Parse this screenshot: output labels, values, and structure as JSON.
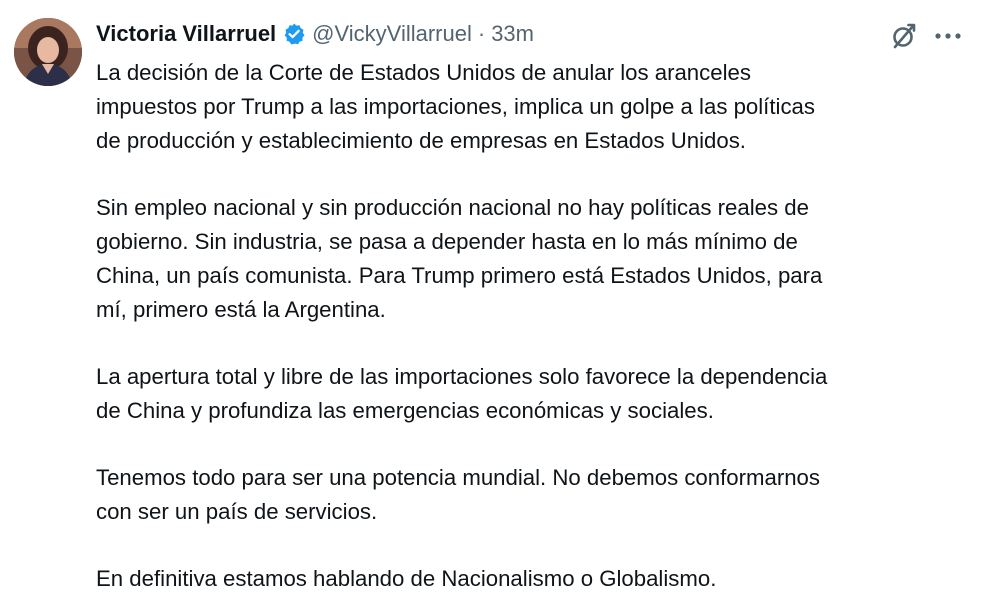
{
  "tweet": {
    "display_name": "Victoria Villarruel",
    "handle": "@VickyVillarruel",
    "separator": "·",
    "time": "33m",
    "verified_icon": "verified-badge-icon",
    "avatar_icon": "profile-photo",
    "actions": {
      "grok_icon": "grok-icon",
      "more_icon": "more-options-icon"
    },
    "paragraphs": [
      "La decisión de la Corte de Estados Unidos de anular los aranceles\nimpuestos por Trump a las importaciones, implica un golpe a las políticas\nde producción y establecimiento de empresas en Estados Unidos.",
      "Sin empleo nacional y sin producción nacional no hay políticas reales de\ngobierno. Sin industria, se pasa a depender hasta en lo más mínimo de\nChina, un país comunista.  Para Trump primero está Estados Unidos, para\nmí, primero está la Argentina.",
      "La apertura total y libre de las importaciones solo favorece la dependencia\nde China y profundiza las emergencias económicas y sociales.",
      "Tenemos todo para ser una potencia mundial. No debemos conformarnos\ncon ser un país de servicios.",
      "En definitiva estamos hablando de Nacionalismo o Globalismo."
    ]
  },
  "colors": {
    "text_primary": "#0f1419",
    "text_secondary": "#536471",
    "verified_blue": "#1d9bf0",
    "background": "#ffffff"
  }
}
